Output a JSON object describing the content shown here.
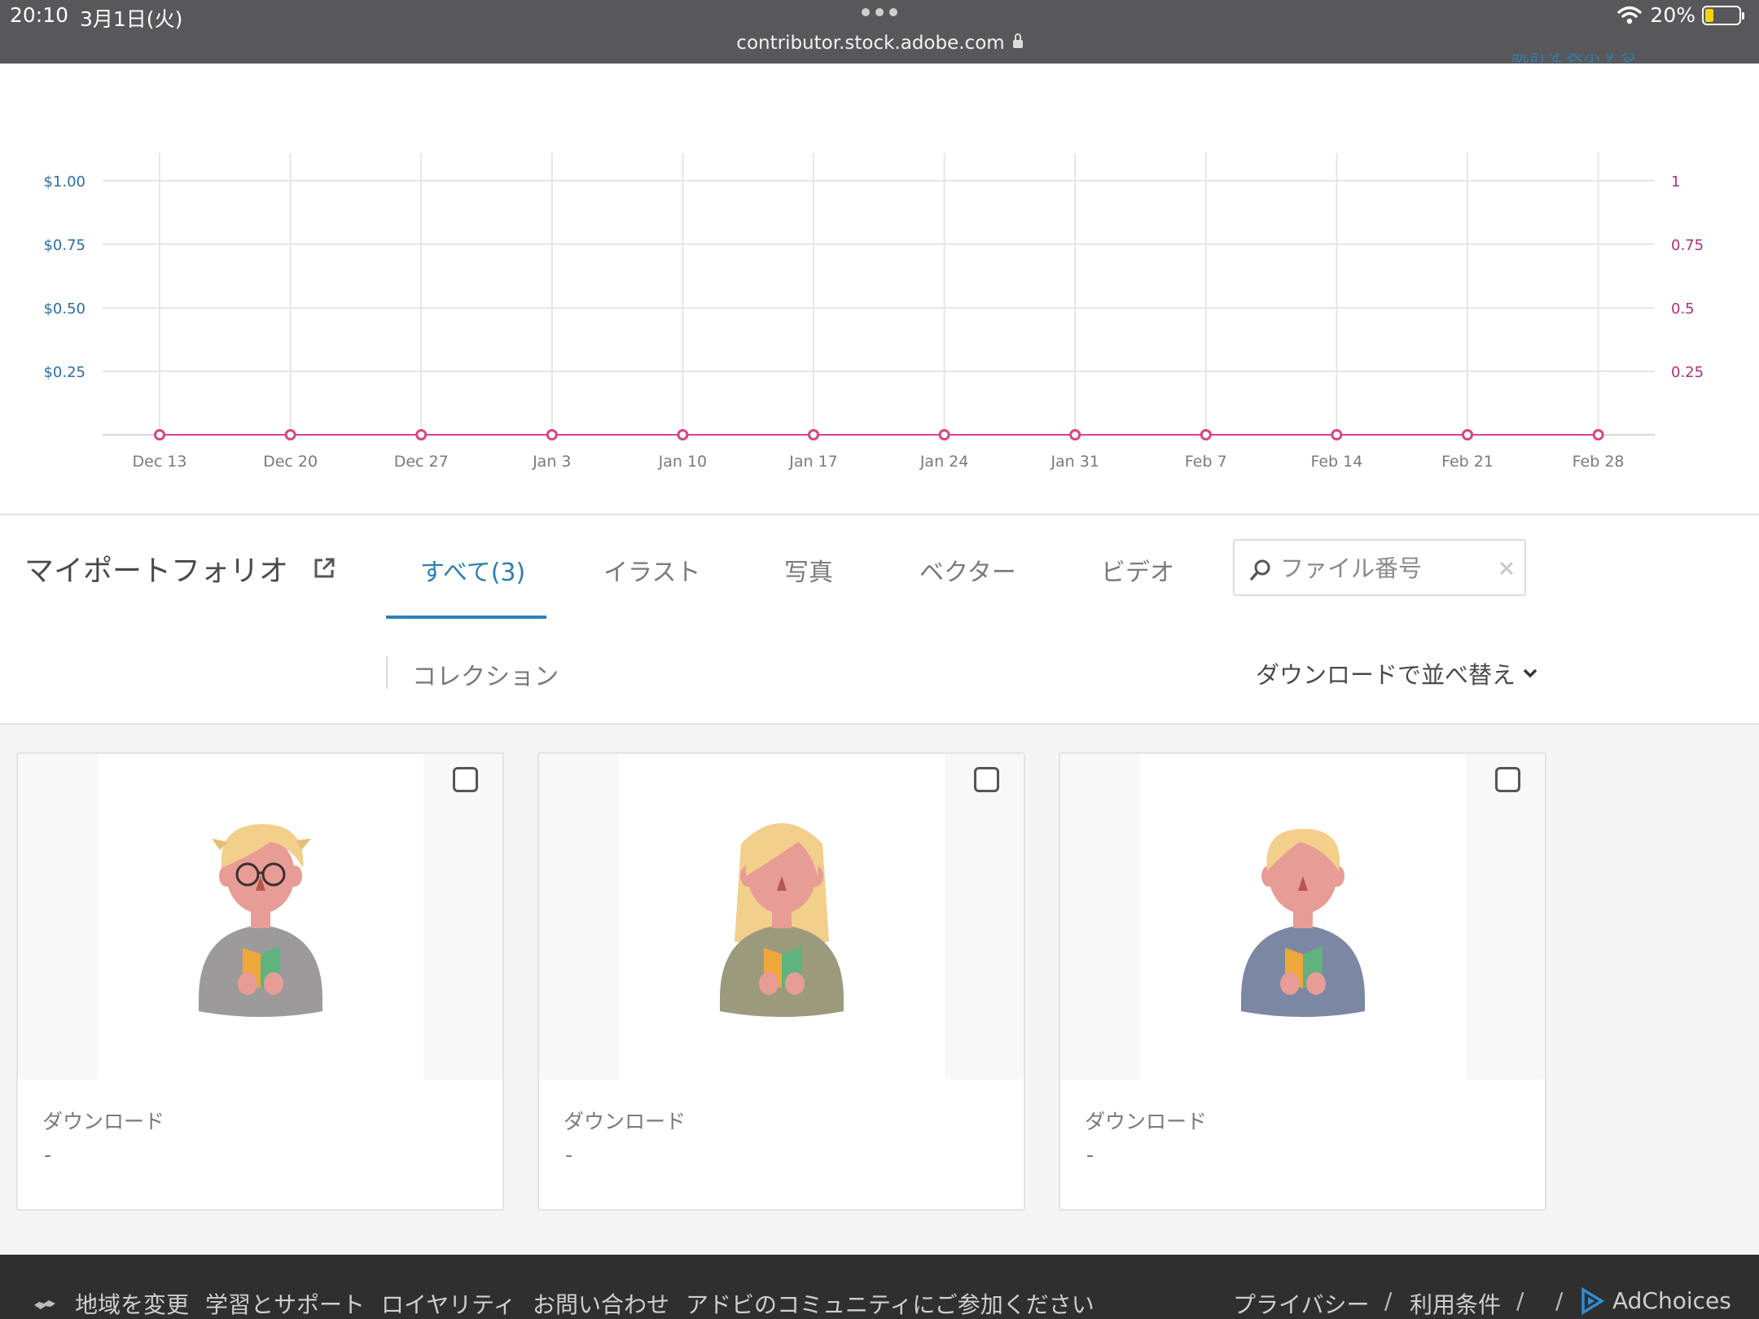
{
  "status_bar": {
    "time": "20:10",
    "date": "3月1日(火)",
    "url": "contributor.stock.adobe.com",
    "battery": "20%"
  },
  "stats_link": "統計を表示する",
  "chart_data": {
    "type": "line",
    "x": [
      "Dec 13",
      "Dec 20",
      "Dec 27",
      "Jan 3",
      "Jan 10",
      "Jan 17",
      "Jan 24",
      "Jan 31",
      "Feb 7",
      "Feb 14",
      "Feb 21",
      "Feb 28"
    ],
    "series": [
      {
        "values": [
          0,
          0,
          0,
          0,
          0,
          0,
          0,
          0,
          0,
          0,
          0,
          0
        ],
        "color": "#d6458a"
      }
    ],
    "y_left_ticks": [
      "$0.25",
      "$0.50",
      "$0.75",
      "$1.00"
    ],
    "y_right_ticks": [
      "0.25",
      "0.5",
      "0.75",
      "1"
    ],
    "ylim": [
      0,
      1
    ],
    "grid": true,
    "colors": {
      "left_axis": "#2d6fa0",
      "right_axis": "#b0307a",
      "grid": "#e6e6e6"
    }
  },
  "portfolio": {
    "title": "マイポートフォリオ",
    "tabs": [
      {
        "label": "すべて(3)",
        "active": true
      },
      {
        "label": "イラスト",
        "active": false
      },
      {
        "label": "写真",
        "active": false
      },
      {
        "label": "ベクター",
        "active": false
      },
      {
        "label": "ビデオ",
        "active": false
      }
    ],
    "search_placeholder": "ファイル番号",
    "collection_label": "コレクション",
    "sort_label": "ダウンロードで並べ替え"
  },
  "cards": [
    {
      "meta_label": "ダウンロード",
      "meta_value": "-",
      "sweater": "#9c9a9b",
      "glasses": true,
      "hair": "short"
    },
    {
      "meta_label": "ダウンロード",
      "meta_value": "-",
      "sweater": "#9b9a7d",
      "glasses": false,
      "hair": "long"
    },
    {
      "meta_label": "ダウンロード",
      "meta_value": "-",
      "sweater": "#7c87a3",
      "glasses": false,
      "hair": "bob"
    }
  ],
  "footer": {
    "links": [
      "地域を変更",
      "学習とサポート",
      "ロイヤリティ",
      "お問い合わせ",
      "アドビのコミュニティにご参加ください"
    ],
    "right_links": [
      "プライバシー",
      "利用条件"
    ],
    "separator": "/",
    "adchoices": "AdChoices"
  }
}
